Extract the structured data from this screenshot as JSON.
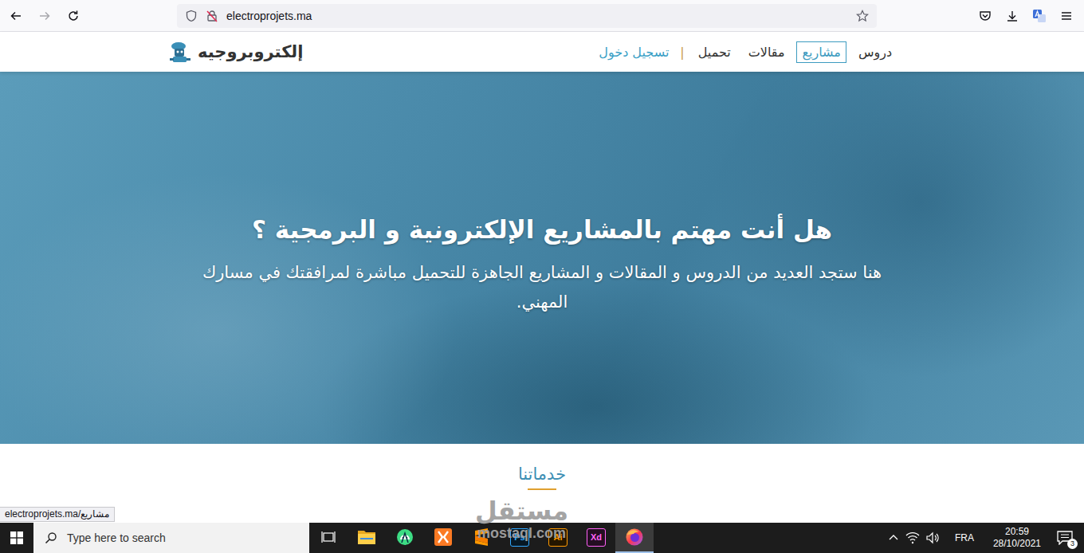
{
  "browser": {
    "url": "electroprojets.ma",
    "status_link": "electroprojets.ma/مشاريع"
  },
  "site": {
    "logo": "إلكتروبروجيه",
    "nav": [
      {
        "label": "دروس",
        "selected": false
      },
      {
        "label": "مشاريع",
        "selected": true
      },
      {
        "label": "مقالات",
        "selected": false
      },
      {
        "label": "تحميل",
        "selected": false
      }
    ],
    "separator": "|",
    "login": "تسجيل دخول"
  },
  "hero": {
    "title": "هل أنت مهتم بالمشاريع الإلكترونية و البرمجية ؟",
    "subtitle": "هنا ستجد العديد من الدروس و المقالات و المشاريع الجاهزة للتحميل مباشرة لمرافقتك في مسارك المهني."
  },
  "section": {
    "title": "خدماتنا"
  },
  "watermark": {
    "arabic": "مستقل",
    "latin": "mostaql.com"
  },
  "taskbar": {
    "search_placeholder": "Type here to search",
    "apps": [
      {
        "kind": "folder",
        "active": false
      },
      {
        "kind": "android",
        "active": false
      },
      {
        "kind": "xampp",
        "active": false
      },
      {
        "kind": "sublime",
        "active": false
      },
      {
        "kind": "adobe",
        "label": "Ps",
        "color": "#31a8ff",
        "active": false
      },
      {
        "kind": "adobe",
        "label": "Ai",
        "color": "#ff9a00",
        "active": false
      },
      {
        "kind": "adobe",
        "label": "Xd",
        "color": "#ff61f6",
        "active": false
      },
      {
        "kind": "firefox",
        "active": true
      }
    ],
    "language": "FRA",
    "time": "20:59",
    "date": "28/10/2021",
    "notifications": "3"
  }
}
